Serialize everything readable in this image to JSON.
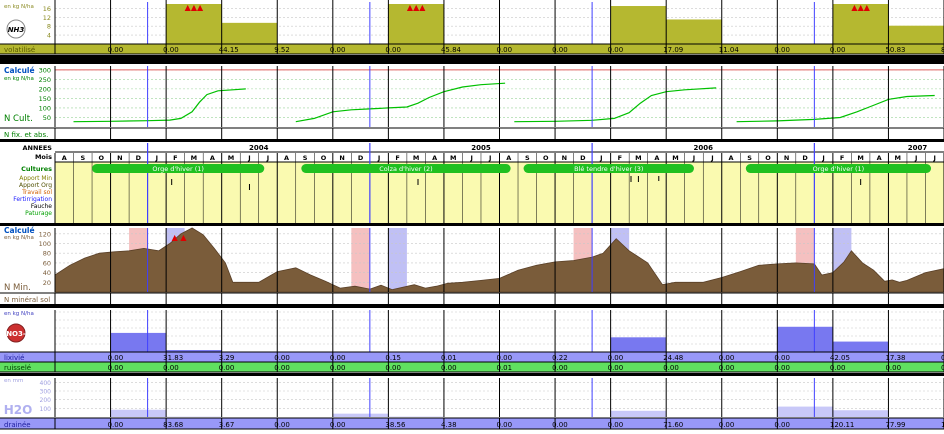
{
  "units": {
    "kg_ha": "en kg N/ha",
    "mm": "en mm"
  },
  "panels": {
    "nh3": {
      "badge": "NH3",
      "row_label": "volatilisé"
    },
    "ncult": {
      "title": "Calculé",
      "label": "N Cult.",
      "row_label": "N fix. et abs."
    },
    "calendar": {
      "labels": [
        "ANNEES",
        "Mois",
        "Cultures",
        "Apport Min",
        "Apport Org",
        "Travail sol",
        "Fertirrigation",
        "Fauche",
        "Paturage"
      ]
    },
    "nmin": {
      "title": "Calculé",
      "label": "N Min.",
      "row_label": "N minéral sol"
    },
    "no3": {
      "badge": "NO3-",
      "row_label": "lixivié",
      "row2_label": "ruisselé"
    },
    "h2o": {
      "badge": "H2O",
      "row_label": "drainée"
    }
  },
  "years": [
    "2004",
    "2005",
    "2006",
    "2007"
  ],
  "months": [
    "A",
    "S",
    "O",
    "N",
    "D",
    "J",
    "F",
    "M",
    "A",
    "M",
    "J",
    "J",
    "A",
    "S",
    "O",
    "N",
    "D",
    "J",
    "F",
    "M",
    "A",
    "M",
    "J",
    "J",
    "A",
    "S",
    "O",
    "N",
    "D",
    "J",
    "F",
    "M",
    "A",
    "M",
    "J",
    "J",
    "A",
    "S",
    "O",
    "N",
    "D",
    "J",
    "F",
    "M",
    "A",
    "M",
    "J",
    "J"
  ],
  "crops": [
    "Orge d'hiver (1)",
    "Colza d'hiver (2)",
    "Blé tendre d'hiver (3)",
    "Orge d'hiver (1)"
  ],
  "colors": {
    "olive": "#b5b830",
    "green": "#00c000",
    "brown": "#7a5c3a",
    "blue_bar": "#7878f0",
    "yellow_bg": "#fafab0",
    "green_row": "#60e060",
    "pink": "#f5c0c0",
    "lavender": "#c0c0f5",
    "black": "#000000",
    "crop_green": "#20c020"
  },
  "chart_data": [
    {
      "type": "bar",
      "name": "NH3 volatilisé",
      "unit": "en kg N/ha",
      "yticks": [
        "16",
        "12",
        "8",
        "4"
      ],
      "ylim": [
        0,
        18
      ],
      "periods": 16,
      "values": [
        "0.00",
        "0.00",
        "44.15",
        "9.52",
        "0.00",
        "0.00",
        "45.84",
        "0.00",
        "0.00",
        "0.00",
        "17.09",
        "11.04",
        "0.00",
        "0.00",
        "50.83",
        "8.24"
      ],
      "bars": [
        0,
        0,
        18,
        9.52,
        0,
        0,
        18,
        0,
        0,
        0,
        17.09,
        11.04,
        0,
        0,
        18,
        8.24
      ],
      "overflow_markers": [
        2,
        6,
        14
      ],
      "marker_glyph": "▲▲▲"
    },
    {
      "type": "line",
      "name": "N Cult.",
      "unit": "en kg N/ha",
      "yticks": [
        "300",
        "250",
        "200",
        "150",
        "100",
        "50"
      ],
      "ylim": [
        0,
        320
      ],
      "x_months": [
        0,
        8,
        9,
        10,
        11,
        12
      ],
      "y_values": [
        28,
        200,
        230,
        240,
        250,
        260
      ],
      "segments": [
        {
          "x": [
            1,
            3,
            5,
            6.2,
            6.8,
            7.4,
            7.8,
            8.2,
            8.8,
            9.6,
            10.3
          ],
          "y": [
            28,
            30,
            33,
            36,
            45,
            80,
            130,
            170,
            190,
            195,
            200
          ]
        },
        {
          "x": [
            13,
            14,
            15,
            16,
            17,
            18,
            19,
            19.6,
            20.2,
            21,
            22,
            23,
            24.3
          ],
          "y": [
            28,
            45,
            80,
            90,
            95,
            100,
            105,
            125,
            155,
            185,
            210,
            222,
            230
          ]
        },
        {
          "x": [
            24.8,
            27,
            29,
            30.2,
            31,
            31.6,
            32.2,
            33,
            34,
            35.7
          ],
          "y": [
            28,
            30,
            35,
            45,
            75,
            125,
            165,
            185,
            195,
            205
          ]
        },
        {
          "x": [
            36.8,
            39,
            41,
            42.4,
            43.3,
            44.1,
            45,
            46,
            47.5
          ],
          "y": [
            28,
            32,
            40,
            50,
            80,
            110,
            145,
            160,
            165
          ]
        }
      ]
    },
    {
      "type": "area",
      "name": "N Min.",
      "unit": "en kg N/ha",
      "yticks": [
        "120",
        "100",
        "80",
        "60",
        "40",
        "20"
      ],
      "ylim": [
        0,
        132
      ],
      "x": [
        0,
        0.8,
        1.6,
        2.4,
        3.2,
        4,
        4.8,
        5.6,
        6.2,
        6.8,
        7.4,
        8,
        8.6,
        9.2,
        9.6,
        10,
        11,
        12,
        13,
        13.8,
        14.6,
        15.4,
        16.2,
        17,
        17.6,
        18.2,
        18.8,
        19.4,
        20,
        20.6,
        21.2,
        22,
        23,
        24,
        25,
        26,
        27,
        28,
        29,
        29.6,
        30.3,
        31,
        32,
        32.8,
        33.5,
        34,
        35,
        36,
        37,
        38,
        39,
        40,
        41,
        41.4,
        42,
        42.6,
        43,
        43.6,
        44.2,
        44.8,
        45.2,
        45.6,
        46,
        47,
        48
      ],
      "y": [
        35,
        55,
        70,
        80,
        83,
        85,
        90,
        85,
        100,
        120,
        132,
        118,
        90,
        60,
        20,
        20,
        20,
        42,
        50,
        35,
        22,
        8,
        12,
        6,
        14,
        5,
        10,
        15,
        8,
        12,
        18,
        20,
        24,
        28,
        45,
        55,
        62,
        65,
        72,
        80,
        110,
        85,
        60,
        15,
        20,
        20,
        20,
        30,
        42,
        55,
        58,
        60,
        58,
        35,
        40,
        62,
        85,
        60,
        45,
        22,
        25,
        20,
        24,
        40,
        48
      ],
      "shaded": [
        {
          "from": 4,
          "to": 5,
          "type": "pink"
        },
        {
          "from": 6,
          "to": 7,
          "type": "lavender"
        },
        {
          "from": 16,
          "to": 17,
          "type": "pink"
        },
        {
          "from": 18,
          "to": 19,
          "type": "lavender"
        },
        {
          "from": 28,
          "to": 29,
          "type": "pink"
        },
        {
          "from": 30,
          "to": 31,
          "type": "lavender"
        },
        {
          "from": 40,
          "to": 41,
          "type": "pink"
        },
        {
          "from": 42,
          "to": 43,
          "type": "lavender"
        }
      ],
      "markers": [
        {
          "x": 6.7,
          "glyph": "▲ ▲"
        }
      ]
    },
    {
      "type": "bar",
      "name": "NO3 lixivié",
      "unit": "en kg N/ha",
      "periods": 16,
      "values": [
        "0.00",
        "31.83",
        "3.29",
        "0.00",
        "0.00",
        "0.15",
        "0.01",
        "0.00",
        "0.22",
        "0.00",
        "24.48",
        "0.00",
        "0.00",
        "42.05",
        "17.38",
        "0.02"
      ],
      "bars": [
        0,
        31.83,
        3.29,
        0,
        0,
        0.15,
        0.01,
        0,
        0.22,
        0,
        24.48,
        0,
        0,
        42.05,
        17.38,
        0.02
      ],
      "ylim": [
        0,
        70
      ],
      "ruissele_values": [
        "0.00",
        "0.00",
        "0.00",
        "0.00",
        "0.00",
        "0.00",
        "0.00",
        "0.01",
        "0.00",
        "0.00",
        "0.00",
        "0.00",
        "0.00",
        "0.00",
        "0.00",
        "0.00"
      ]
    },
    {
      "type": "bar",
      "name": "H2O drainée",
      "unit": "en mm",
      "yticks": [
        "400",
        "300",
        "200",
        "100"
      ],
      "ylim": [
        0,
        450
      ],
      "periods": 16,
      "values": [
        "0.00",
        "83.68",
        "3.67",
        "0.00",
        "0.00",
        "38.56",
        "4.38",
        "0.00",
        "0.00",
        "0.00",
        "71.60",
        "0.00",
        "0.00",
        "120.11",
        "77.99",
        "1.82"
      ],
      "bars": [
        0,
        83.68,
        3.67,
        0,
        0,
        38.56,
        4.38,
        0,
        0,
        0,
        71.6,
        0,
        0,
        120.11,
        77.99,
        1.82
      ]
    }
  ]
}
